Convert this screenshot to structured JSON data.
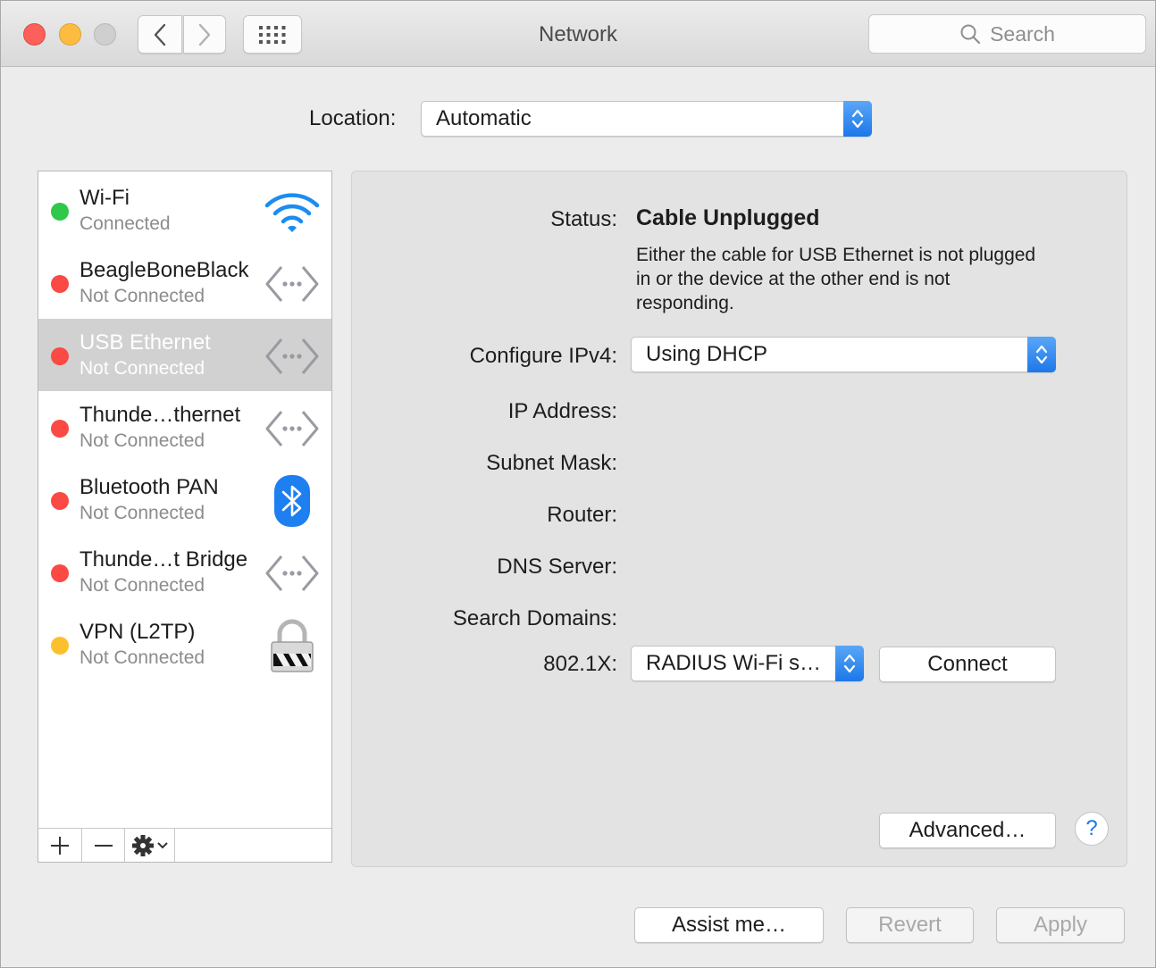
{
  "window": {
    "title": "Network",
    "search_placeholder": "Search"
  },
  "location": {
    "label": "Location:",
    "value": "Automatic"
  },
  "services": [
    {
      "name": "Wi-Fi",
      "state": "Connected",
      "status_color": "#2fc84a",
      "icon": "wifi-icon",
      "selected": false
    },
    {
      "name": "BeagleBoneBlack",
      "state": "Not Connected",
      "status_color": "#fb4943",
      "icon": "ethernet-icon",
      "selected": false
    },
    {
      "name": "USB Ethernet",
      "state": "Not Connected",
      "status_color": "#fb4943",
      "icon": "ethernet-icon",
      "selected": true
    },
    {
      "name": "Thunde…thernet",
      "state": "Not Connected",
      "status_color": "#fb4943",
      "icon": "ethernet-icon",
      "selected": false
    },
    {
      "name": "Bluetooth PAN",
      "state": "Not Connected",
      "status_color": "#fb4943",
      "icon": "bluetooth-icon",
      "selected": false
    },
    {
      "name": "Thunde…t Bridge",
      "state": "Not Connected",
      "status_color": "#fb4943",
      "icon": "ethernet-icon",
      "selected": false
    },
    {
      "name": "VPN (L2TP)",
      "state": "Not Connected",
      "status_color": "#fcc02e",
      "icon": "lock-icon",
      "selected": false
    }
  ],
  "detail": {
    "status_label": "Status:",
    "status_value": "Cable Unplugged",
    "status_description": "Either the cable for USB Ethernet is not plugged in or the device at the other end is not responding.",
    "configure_label": "Configure IPv4:",
    "configure_value": "Using DHCP",
    "ip_label": "IP Address:",
    "subnet_label": "Subnet Mask:",
    "router_label": "Router:",
    "dns_label": "DNS Server:",
    "search_domains_label": "Search Domains:",
    "dot1x_label": "802.1X:",
    "dot1x_value": "RADIUS Wi-Fi s…",
    "connect_label": "Connect",
    "advanced_label": "Advanced…",
    "help_label": "?"
  },
  "footer": {
    "assist_label": "Assist me…",
    "revert_label": "Revert",
    "apply_label": "Apply"
  },
  "colors": {
    "accent": "#1c77e9",
    "selected_row": "#d1d1d1"
  }
}
